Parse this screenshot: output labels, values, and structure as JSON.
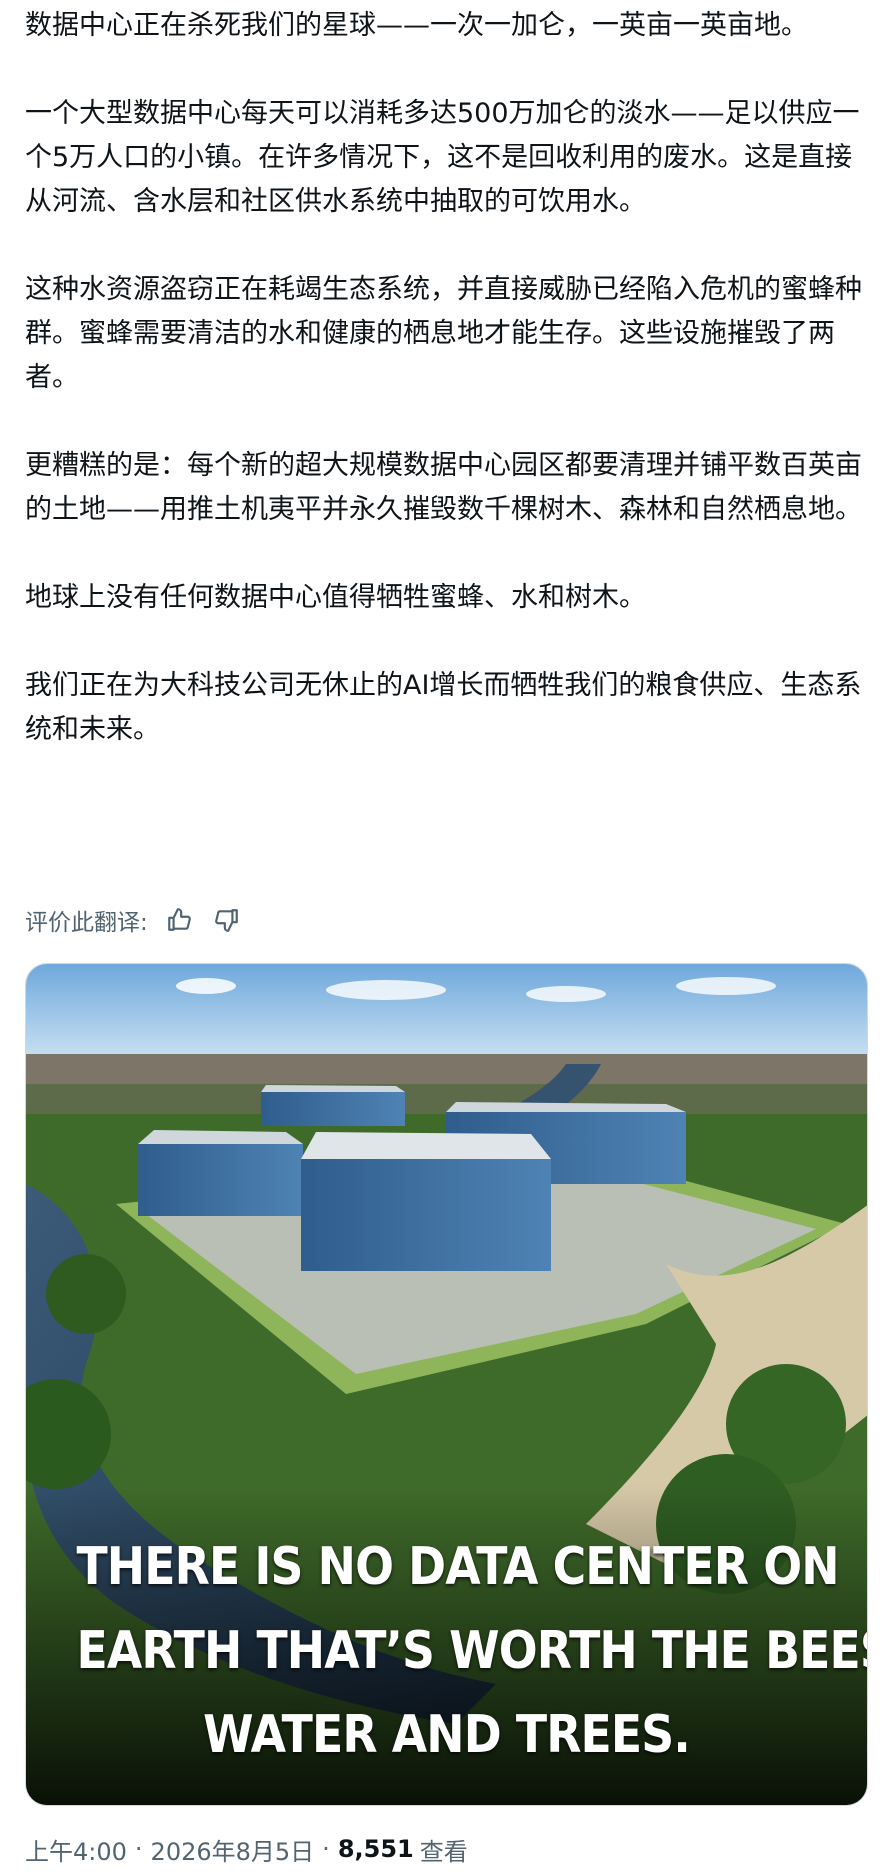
{
  "post": {
    "paragraphs": [
      "数据中心正在杀死我们的星球——一次一加仑，一英亩一英亩地。",
      "一个大型数据中心每天可以消耗多达500万加仑的淡水——足以供应一个5万人口的小镇。在许多情况下，这不是回收利用的废水。这是直接从河流、含水层和社区供水系统中抽取的可饮用水。",
      "这种水资源盗窃正在耗竭生态系统，并直接威胁已经陷入危机的蜜蜂种群。蜜蜂需要清洁的水和健康的栖息地才能生存。这些设施摧毁了两者。",
      "更糟糕的是：每个新的超大规模数据中心园区都要清理并铺平数百英亩的土地——用推土机夷平并永久摧毁数千棵树木、森林和自然栖息地。",
      "地球上没有任何数据中心值得牺牲蜜蜂、水和树木。",
      "我们正在为大科技公司无休止的AI增长而牺牲我们的粮食供应、生态系统和未来。"
    ]
  },
  "rating": {
    "label": "评价此翻译:",
    "like_icon": "thumbs-up-icon",
    "dislike_icon": "thumbs-down-icon"
  },
  "image": {
    "caption_lines": [
      "THERE IS NO DATA CENTER ON",
      "EARTH THAT’S WORTH THE BEES,",
      "WATER AND TREES."
    ]
  },
  "meta": {
    "time": "上午4:00",
    "date": "2026年8月5日",
    "views_count": "8,551",
    "views_label": "查看"
  },
  "colors": {
    "text": "#0f1419",
    "secondary": "#536471"
  }
}
